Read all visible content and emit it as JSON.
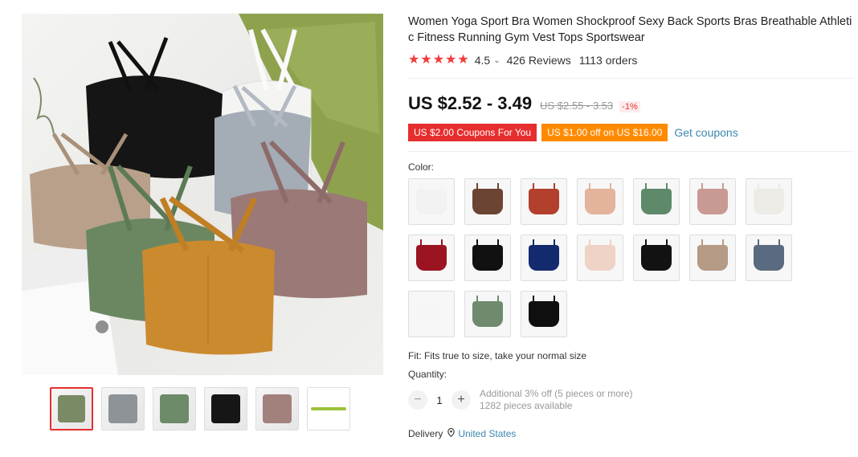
{
  "product": {
    "title": "Women Yoga Sport Bra Women Shockproof Sexy Back Sports Bras Breathable Athletic Fitness Running Gym Vest Tops Sportswear",
    "rating_value": "4.5",
    "rating_stars": 4.5,
    "reviews": "426 Reviews",
    "orders": "1113 orders",
    "price": "US $2.52 - 3.49",
    "old_price": "US $2.55 - 3.53",
    "discount": "-1%"
  },
  "coupons": {
    "coupon1": "US $2.00 Coupons For You",
    "coupon2": "US $1.00 off on US $16.00",
    "get_coupons": "Get coupons"
  },
  "options": {
    "color_label": "Color:",
    "fit": "Fit: Fits true to size, take your normal size",
    "quantity_label": "Quantity:",
    "quantity_value": "1",
    "minus": "−",
    "plus": "+",
    "additional": "Additional 3% off (5 pieces or more)",
    "available": "1282 pieces available"
  },
  "delivery": {
    "label": "Delivery",
    "country": "United States"
  },
  "colors": {
    "accent_red": "#e62e2e",
    "coupon_orange": "#ff8a00",
    "link_blue": "#3a87ad"
  },
  "swatch_colors": [
    "#f2f2f2",
    "#6b4434",
    "#b3402c",
    "#e3b39b",
    "#5f8a69",
    "#c99a93",
    "#ecebe6",
    "#9a1422",
    "#111111",
    "#142a6e",
    "#efd3c7",
    "#121212",
    "#b59a86",
    "#5a6a80",
    "#f6f6f6",
    "#6f8a6f",
    "#0f0f0f"
  ],
  "thumb_colors": [
    "#7a8a64",
    "#8e9398",
    "#6d8b68",
    "#161616",
    "#a2817c",
    "#9cc23a"
  ]
}
